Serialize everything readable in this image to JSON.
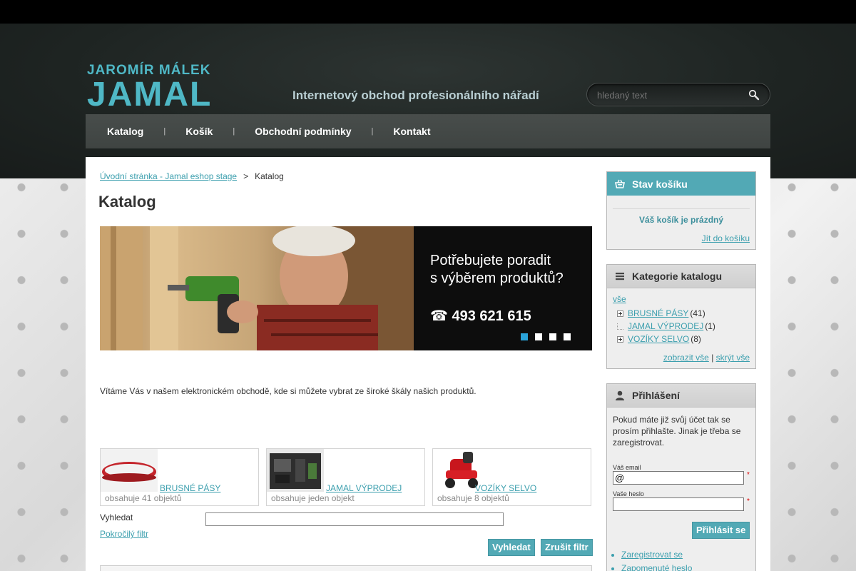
{
  "header": {
    "logo_top": "JAROMÍR MÁLEK",
    "logo_main": "JAMAL",
    "tagline": "Internetový obchod profesionálního nářadí",
    "search_placeholder": "hledaný text"
  },
  "nav": {
    "items": [
      "Katalog",
      "Košík",
      "Obchodní podmínky",
      "Kontakt"
    ]
  },
  "breadcrumb": {
    "home": "Úvodní stránka - Jamal eshop stage",
    "separator": ">",
    "current": "Katalog"
  },
  "page": {
    "title": "Katalog",
    "welcome": "Vítáme Vás v našem elektronickém obchodě, kde si můžete vybrat ze široké škály našich produktů."
  },
  "banner": {
    "text": "Potřebujete poradit\ns výběrem produktů?",
    "phone": "☎ 493 621 615",
    "slides": 4,
    "active_slide": 1
  },
  "categories": [
    {
      "name": "BRUSNÉ PÁSY",
      "count": "obsahuje 41 objektů"
    },
    {
      "name": "JAMAL VÝPRODEJ",
      "count": "obsahuje jeden objekt"
    },
    {
      "name": "VOZÍKY SELVO",
      "count": "obsahuje 8 objektů"
    }
  ],
  "filter": {
    "label": "Vyhledat",
    "advanced": "Pokročilý filtr",
    "search_button": "Vyhledat",
    "reset_button": "Zrušit filtr"
  },
  "sidebar": {
    "cart": {
      "title": "Stav košíku",
      "empty": "Váš košík je prázdný",
      "go": "Jít do košíku"
    },
    "catalog": {
      "title": "Kategorie katalogu",
      "all": "vše",
      "items": [
        {
          "name": "BRUSNÉ PÁSY",
          "count": "(41)"
        },
        {
          "name": "JAMAL VÝPRODEJ",
          "count": "(1)"
        },
        {
          "name": "VOZÍKY SELVO",
          "count": "(8)"
        }
      ],
      "show_all": "zobrazit vše",
      "divider": "|",
      "hide_all": "skrýt vše"
    },
    "login": {
      "title": "Přihlášení",
      "intro": "Pokud máte již svůj účet tak se prosím přihlašte. Jinak je třeba se zaregistrovat.",
      "email_label": "Váš email",
      "email_value": "@",
      "password_label": "Vaše heslo",
      "required_mark": "*",
      "submit": "Přihlásit se",
      "register": "Zaregistrovat se",
      "forgot": "Zapomenuté heslo"
    }
  },
  "colors": {
    "accent": "#52a9b5",
    "link": "#3c9fae",
    "header_bg": "#1e2422",
    "nav_bg": "#484d4b",
    "banner_dot_active": "#2aa3d9"
  }
}
